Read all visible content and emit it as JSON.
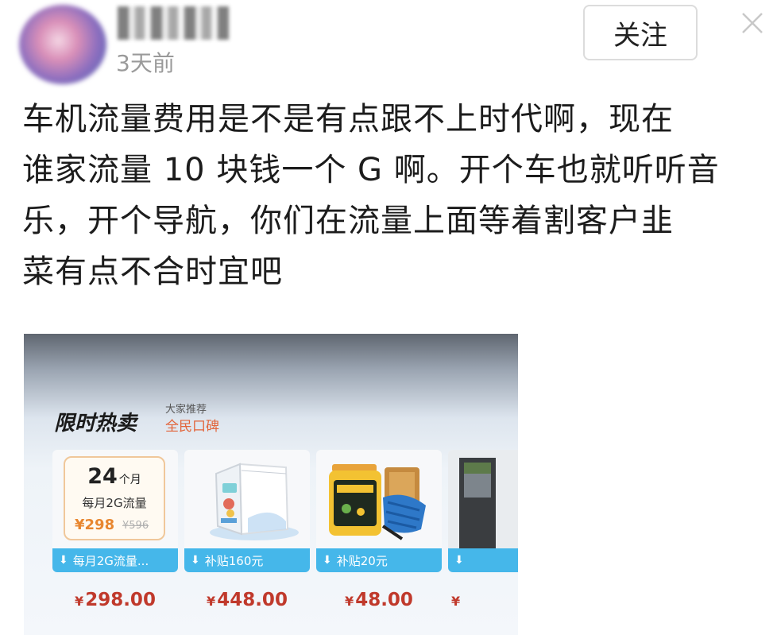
{
  "post": {
    "time": "3天前",
    "follow_label": "关注",
    "lines": [
      "车机流量费用是不是有点跟不上时代啊，现在",
      "谁家流量 10 块钱一个 G 啊。开个车也就听听音",
      "乐，开个导航，你们在流量上面等着割客户韭",
      "菜有点不合时宜吧"
    ]
  },
  "ad": {
    "title": "限时热卖",
    "sub1": "大家推荐",
    "sub2": "全民口碑",
    "plan": {
      "months": "24",
      "months_unit": "个月",
      "desc": "每月2G流量",
      "price": "¥298",
      "orig_price": "¥596"
    },
    "products": [
      {
        "subsidy": "每月2G流量...",
        "price": "298.00"
      },
      {
        "subsidy": "补贴160元",
        "price": "448.00"
      },
      {
        "subsidy": "补贴20元",
        "price": "48.00"
      },
      {
        "subsidy": "",
        "price": ""
      }
    ],
    "currency": "¥",
    "icons": {
      "subsidy": "down-arrow-icon",
      "close": "close-icon"
    }
  }
}
